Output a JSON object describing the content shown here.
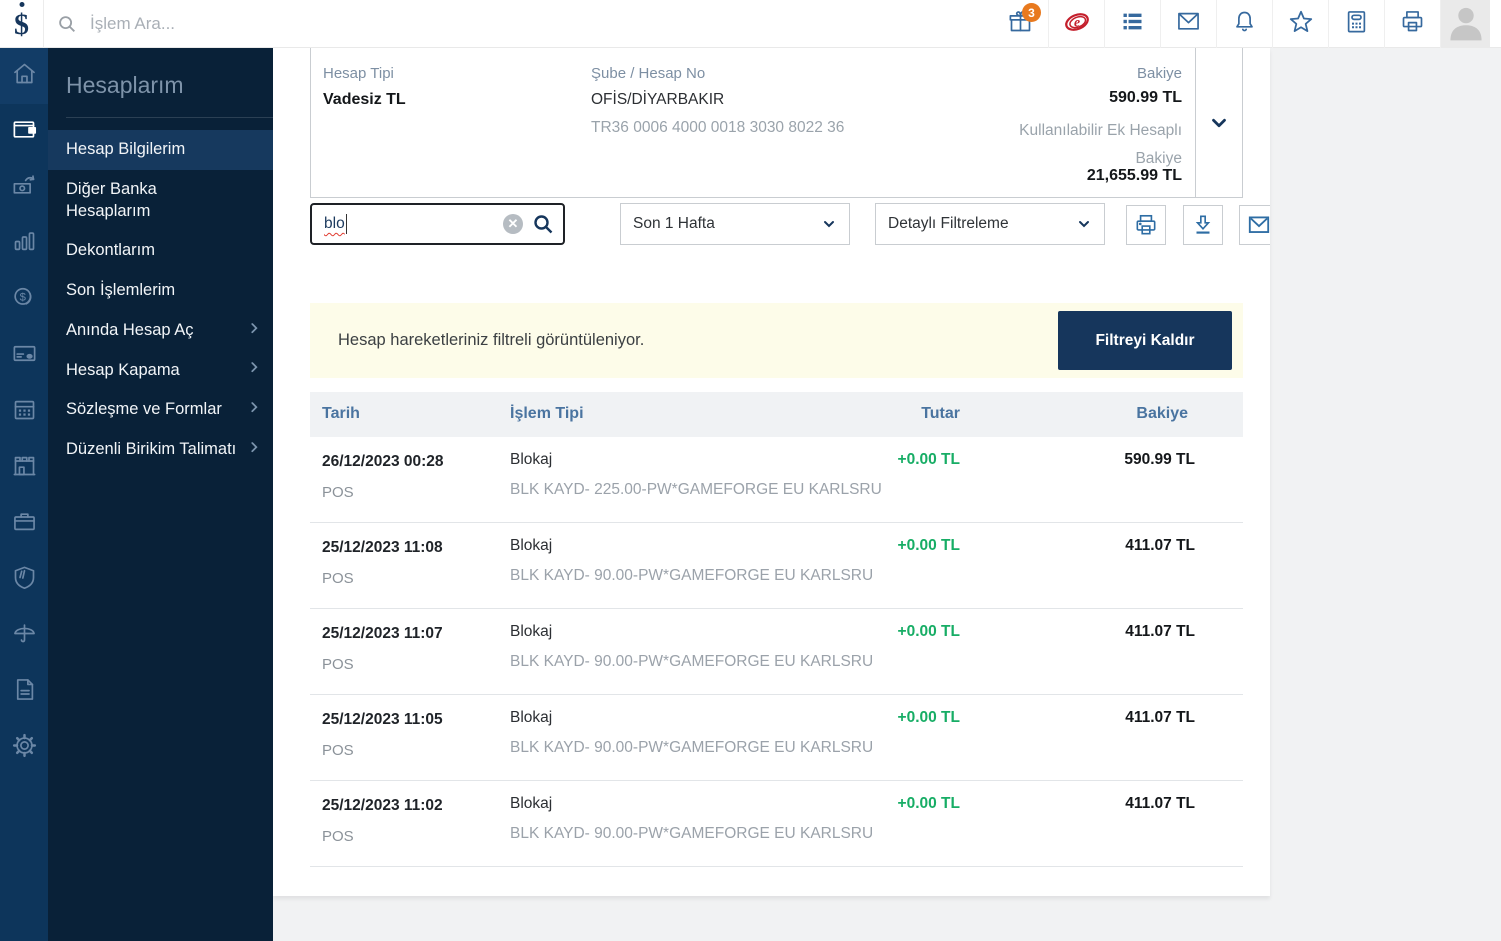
{
  "topbar": {
    "search_placeholder": "İşlem Ara...",
    "icons": [
      {
        "name": "gift-icon",
        "badge": "3"
      },
      {
        "name": "e-bank-logo-icon"
      },
      {
        "name": "list-icon"
      },
      {
        "name": "mail-icon"
      },
      {
        "name": "bell-icon"
      },
      {
        "name": "star-icon"
      },
      {
        "name": "calculator-icon"
      },
      {
        "name": "printer-icon"
      },
      {
        "name": "avatar"
      }
    ]
  },
  "sidebar": {
    "title": "Hesaplarım",
    "rail_icons": [
      {
        "name": "home-icon",
        "first": true
      },
      {
        "name": "wallet-icon",
        "active": true
      },
      {
        "name": "money-transfer-icon"
      },
      {
        "name": "bar-chart-icon"
      },
      {
        "name": "coins-icon"
      },
      {
        "name": "credit-card-icon"
      },
      {
        "name": "calendar-icon"
      },
      {
        "name": "branch-icon"
      },
      {
        "name": "briefcase-icon"
      },
      {
        "name": "shield-icon"
      },
      {
        "name": "umbrella-icon"
      },
      {
        "name": "document-icon"
      },
      {
        "name": "settings-icon"
      }
    ],
    "items": [
      {
        "label": "Hesap Bilgilerim",
        "active": true,
        "chevron": false
      },
      {
        "label": "Diğer Banka Hesaplarım",
        "chevron": false
      },
      {
        "label": "Dekontlarım",
        "chevron": false
      },
      {
        "label": "Son İşlemlerim",
        "chevron": false
      },
      {
        "label": "Anında Hesap Aç",
        "chevron": true
      },
      {
        "label": "Hesap Kapama",
        "chevron": true
      },
      {
        "label": "Sözleşme ve Formlar",
        "chevron": true
      },
      {
        "label": "Düzenli Birikim Talimatı",
        "chevron": true
      }
    ]
  },
  "account_card": {
    "clipped_headers": {
      "type": "Hesap Tipi",
      "branch": "Şube / Hesap No",
      "balance": "Bakiye"
    },
    "account_type": "Vadesiz TL",
    "branch": "OFİS/DİYARBAKIR",
    "iban": "TR36 0006 4000 0018 3030 8022 36",
    "balance": "590.99 TL",
    "available_label_line1": "Kullanılabilir Ek Hesaplı",
    "available_label_line2": "Bakiye",
    "available_balance": "21,655.99 TL"
  },
  "filters": {
    "search_value": "blo",
    "period_select": "Son 1 Hafta",
    "detail_select": "Detaylı Filtreleme"
  },
  "notice": {
    "message": "Hesap hareketleriniz filtreli görüntüleniyor.",
    "button": "Filtreyi Kaldır"
  },
  "table": {
    "headers": {
      "date": "Tarih",
      "type": "İşlem Tipi",
      "amount": "Tutar",
      "balance": "Bakiye"
    },
    "rows": [
      {
        "date": "26/12/2023 00:28",
        "channel": "POS",
        "type": "Blokaj",
        "description": "BLK KAYD- 225.00-PW*GAMEFORGE EU KARLSRU",
        "amount": "+0.00 TL",
        "balance": "590.99 TL"
      },
      {
        "date": "25/12/2023 11:08",
        "channel": "POS",
        "type": "Blokaj",
        "description": "BLK KAYD- 90.00-PW*GAMEFORGE EU KARLSRU",
        "amount": "+0.00 TL",
        "balance": "411.07 TL"
      },
      {
        "date": "25/12/2023 11:07",
        "channel": "POS",
        "type": "Blokaj",
        "description": "BLK KAYD- 90.00-PW*GAMEFORGE EU KARLSRU",
        "amount": "+0.00 TL",
        "balance": "411.07 TL"
      },
      {
        "date": "25/12/2023 11:05",
        "channel": "POS",
        "type": "Blokaj",
        "description": "BLK KAYD- 90.00-PW*GAMEFORGE EU KARLSRU",
        "amount": "+0.00 TL",
        "balance": "411.07 TL"
      },
      {
        "date": "25/12/2023 11:02",
        "channel": "POS",
        "type": "Blokaj",
        "description": "BLK KAYD- 90.00-PW*GAMEFORGE EU KARLSRU",
        "amount": "+0.00 TL",
        "balance": "411.07 TL"
      }
    ]
  },
  "colors": {
    "accent_navy": "#16365c",
    "sidebar_rail": "#0d355b",
    "sidebar_panel": "#092138",
    "green_amount": "#17ad65",
    "badge_orange": "#e8791e",
    "logo_red": "#c41f2c",
    "notice_bg": "#fdfce9"
  }
}
